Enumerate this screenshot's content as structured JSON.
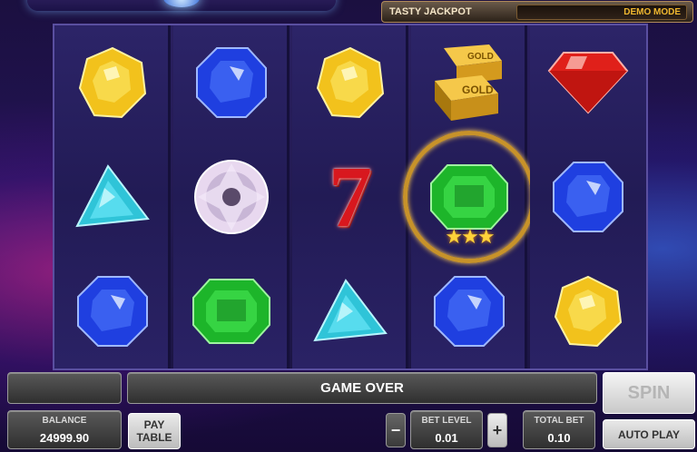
{
  "header": {
    "jackpot_label": "TASTY JACKPOT",
    "mode_label": "DEMO MODE"
  },
  "reels": [
    [
      "yellow-gem",
      "teal-triangle-gem",
      "blue-gem"
    ],
    [
      "blue-gem",
      "diamond",
      "green-gem"
    ],
    [
      "yellow-gem",
      "red-seven",
      "teal-triangle-gem"
    ],
    [
      "gold-bars",
      "green-gem-win",
      "blue-gem"
    ],
    [
      "red-gem",
      "blue-gem",
      "yellow-gem"
    ]
  ],
  "symbols": {
    "gold_text_1": "GOLD",
    "gold_text_2": "GOLD",
    "seven": "7",
    "win_stars": "★★★"
  },
  "controls": {
    "message": "GAME OVER",
    "balance_label": "BALANCE",
    "balance_value": "24999.90",
    "paytable_line1": "PAY",
    "paytable_line2": "TABLE",
    "minus": "−",
    "plus": "+",
    "bet_level_label": "BET LEVEL",
    "bet_level_value": "0.01",
    "total_bet_label": "TOTAL BET",
    "total_bet_value": "0.10",
    "spin_label": "SPIN",
    "autoplay_label": "AUTO PLAY"
  },
  "colors": {
    "yellow": "#f2c21c",
    "blue": "#1f3fe0",
    "red": "#e0201a",
    "green": "#1db52a",
    "teal": "#2fc4d8"
  }
}
